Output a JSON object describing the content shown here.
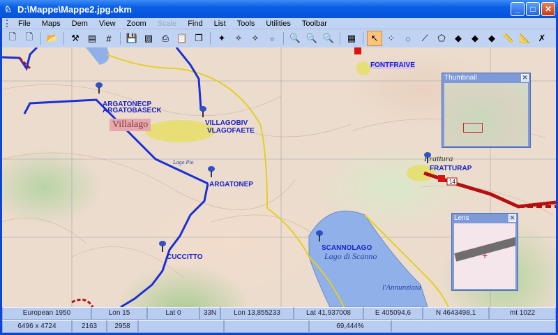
{
  "window": {
    "title": "D:\\Mappe\\Mappe2.jpg.okm",
    "minimize": "_",
    "maximize": "□",
    "close": "✕"
  },
  "menu": [
    "File",
    "Maps",
    "Dem",
    "View",
    "Zoom",
    "Scale",
    "Find",
    "List",
    "Tools",
    "Utilities",
    "Toolbar"
  ],
  "menu_disabled": [
    "Scale"
  ],
  "toolbar": [
    {
      "icon": "new-route-v-icon",
      "glyph": "🗋"
    },
    {
      "icon": "new-route-r-icon",
      "glyph": "🗋"
    },
    {
      "icon": "open-map-icon",
      "glyph": "📂"
    },
    {
      "icon": "tools-icon",
      "glyph": "⚒"
    },
    {
      "icon": "properties-icon",
      "glyph": "▤"
    },
    {
      "icon": "grid-icon",
      "glyph": "#"
    },
    {
      "icon": "save-icon",
      "glyph": "💾"
    },
    {
      "icon": "image-icon",
      "glyph": "▨"
    },
    {
      "icon": "print-icon",
      "glyph": "⎙"
    },
    {
      "icon": "clipboard-icon",
      "glyph": "📋"
    },
    {
      "icon": "window-icon",
      "glyph": "❐"
    },
    {
      "icon": "gps-icon",
      "glyph": "✦"
    },
    {
      "icon": "shp-icon",
      "glyph": "✧"
    },
    {
      "icon": "dcw-icon",
      "glyph": "✧"
    },
    {
      "icon": "shp-disabled-icon",
      "glyph": "▫"
    },
    {
      "icon": "zoom-in-icon",
      "glyph": "🔍"
    },
    {
      "icon": "zoom-out-icon",
      "glyph": "🔍"
    },
    {
      "icon": "zoom-fit-icon",
      "glyph": "🔍"
    },
    {
      "icon": "table-edit-icon",
      "glyph": "▦"
    },
    {
      "icon": "select-pointer-icon",
      "glyph": "↖"
    },
    {
      "icon": "draw-points-icon",
      "glyph": "⁘"
    },
    {
      "icon": "draw-circle-icon",
      "glyph": "◌"
    },
    {
      "icon": "draw-polyline-icon",
      "glyph": "⟋"
    },
    {
      "icon": "draw-polygon-icon",
      "glyph": "⬠"
    },
    {
      "icon": "waypoint-icon",
      "glyph": "◆"
    },
    {
      "icon": "route-node-icon",
      "glyph": "◆"
    },
    {
      "icon": "route-red-icon",
      "glyph": "◆"
    },
    {
      "icon": "ruler-icon",
      "glyph": "📏"
    },
    {
      "icon": "ruler-area-icon",
      "glyph": "📐"
    },
    {
      "icon": "ruler-delete-icon",
      "glyph": "✗"
    }
  ],
  "map": {
    "labels": {
      "argatonecp": "ARGATONECP",
      "argatobaseck": "ARGATOBASECK",
      "villagobiv": "VILLAGOBIV",
      "vlagofaete": "VLAGOFAETE",
      "argatonep": "ARGATONEP",
      "cuccitto": "CUCCITTO",
      "scannolago": "SCANNOLAGO",
      "frattura": "FRATTURAP",
      "fontefraive": "FONTFRAIVE"
    },
    "place_names": {
      "villalago": "Villalago",
      "lago_scanno": "Lago di Scanno",
      "frattura": "Frattura",
      "annunziata": "l'Annunziata",
      "lago_pio": "Lago Pio"
    },
    "road_number": "14"
  },
  "thumbnail": {
    "title": "Thumbnail",
    "close": "✕"
  },
  "lens": {
    "title": "Lens",
    "close": "✕"
  },
  "status": {
    "row1": [
      "European 1950",
      "Lon 15",
      "Lat 0",
      "33N",
      "Lon 13,855233",
      "Lat 41,937008",
      "E 405094,6",
      "N 4643498,1",
      "mt 1022"
    ],
    "row2": [
      "6496 x 4724",
      "2163",
      "2958",
      "",
      "",
      "69,444%",
      ""
    ]
  },
  "colors": {
    "route": "#1a2fd6",
    "road": "#c01818",
    "lake": "#8fb0e8",
    "accent": "#0a5ee6"
  }
}
